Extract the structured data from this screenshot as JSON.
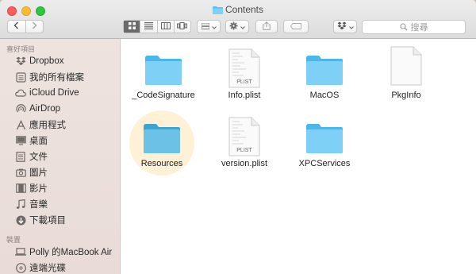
{
  "window": {
    "title": "Contents"
  },
  "toolbar": {
    "back_icon": "chevron-left-icon",
    "forward_icon": "chevron-right-icon",
    "view_modes": [
      "icon-view",
      "list-view",
      "column-view",
      "cover-flow-view"
    ],
    "active_view": "icon-view",
    "search_placeholder": "搜尋"
  },
  "sidebar": {
    "favorites_header": "喜好項目",
    "favorites": [
      {
        "label": "Dropbox",
        "icon": "dropbox-icon"
      },
      {
        "label": "我的所有檔案",
        "icon": "all-files-icon"
      },
      {
        "label": "iCloud Drive",
        "icon": "cloud-icon"
      },
      {
        "label": "AirDrop",
        "icon": "airdrop-icon"
      },
      {
        "label": "應用程式",
        "icon": "applications-icon"
      },
      {
        "label": "桌面",
        "icon": "desktop-icon"
      },
      {
        "label": "文件",
        "icon": "documents-icon"
      },
      {
        "label": "圖片",
        "icon": "pictures-icon"
      },
      {
        "label": "影片",
        "icon": "movies-icon"
      },
      {
        "label": "音樂",
        "icon": "music-icon"
      },
      {
        "label": "下載項目",
        "icon": "downloads-icon"
      }
    ],
    "devices_header": "裝置",
    "devices": [
      {
        "label": "Polly 的MacBook Air",
        "icon": "laptop-icon"
      },
      {
        "label": "遠端光碟",
        "icon": "disc-icon"
      }
    ]
  },
  "files": [
    {
      "name": "_CodeSignature",
      "kind": "folder"
    },
    {
      "name": "Info.plist",
      "kind": "plist",
      "badge": "PLIST"
    },
    {
      "name": "MacOS",
      "kind": "folder"
    },
    {
      "name": "PkgInfo",
      "kind": "document"
    },
    {
      "name": "Resources",
      "kind": "folder",
      "selected": true
    },
    {
      "name": "version.plist",
      "kind": "plist",
      "badge": "PLIST"
    },
    {
      "name": "XPCServices",
      "kind": "folder"
    }
  ],
  "colors": {
    "folder_light": "#7fd0f6",
    "folder_dark": "#4ab6ea",
    "selection_halo": "#fdecc8",
    "sidebar_bg": "#ece1dd",
    "sidebar_icon": "#6e6866"
  }
}
